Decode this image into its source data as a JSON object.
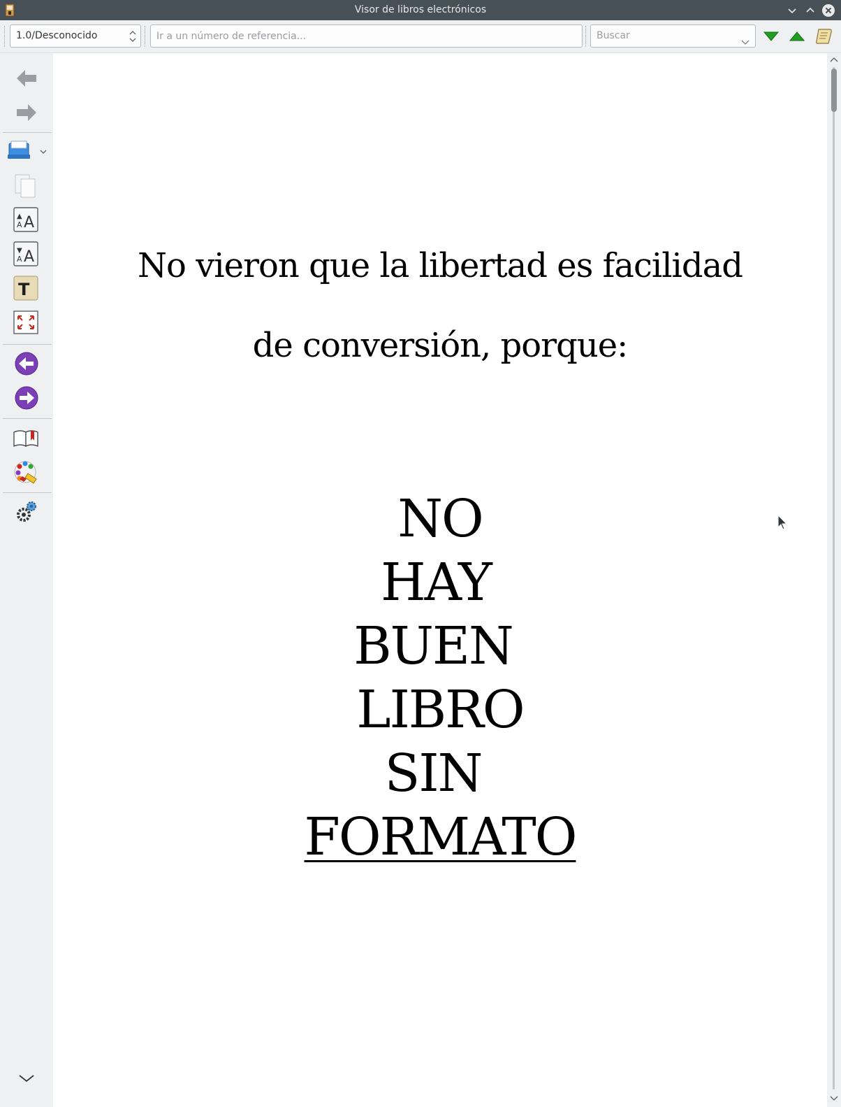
{
  "window": {
    "title": "Visor de libros electrónicos"
  },
  "toolbar": {
    "position_value": "1.0/Desconocido",
    "reference_placeholder": "Ir a un número de referencia...",
    "search_placeholder": "Buscar",
    "icons": [
      "find-next-icon",
      "find-previous-icon",
      "table-of-contents-icon"
    ]
  },
  "sidebar": {
    "icons": [
      "back-icon",
      "forward-icon",
      "print-icon",
      "copy-icon",
      "font-larger-icon",
      "font-smaller-icon",
      "text-style-icon",
      "fullscreen-icon",
      "previous-page-icon",
      "next-page-icon",
      "bookmarks-icon",
      "theme-icon",
      "preferences-icon",
      "more-icon"
    ]
  },
  "book": {
    "line1": "No vieron que la libertad es facilidad",
    "line2": "de conversión, porque:",
    "words": [
      "NO",
      "HAY",
      "BUEN",
      "LIBRO",
      "SIN",
      "FORMATO"
    ]
  },
  "colors": {
    "titlebar": "#475057",
    "accent_purple": "#7b3fb6",
    "arrow_green": "#1f9e1f"
  }
}
